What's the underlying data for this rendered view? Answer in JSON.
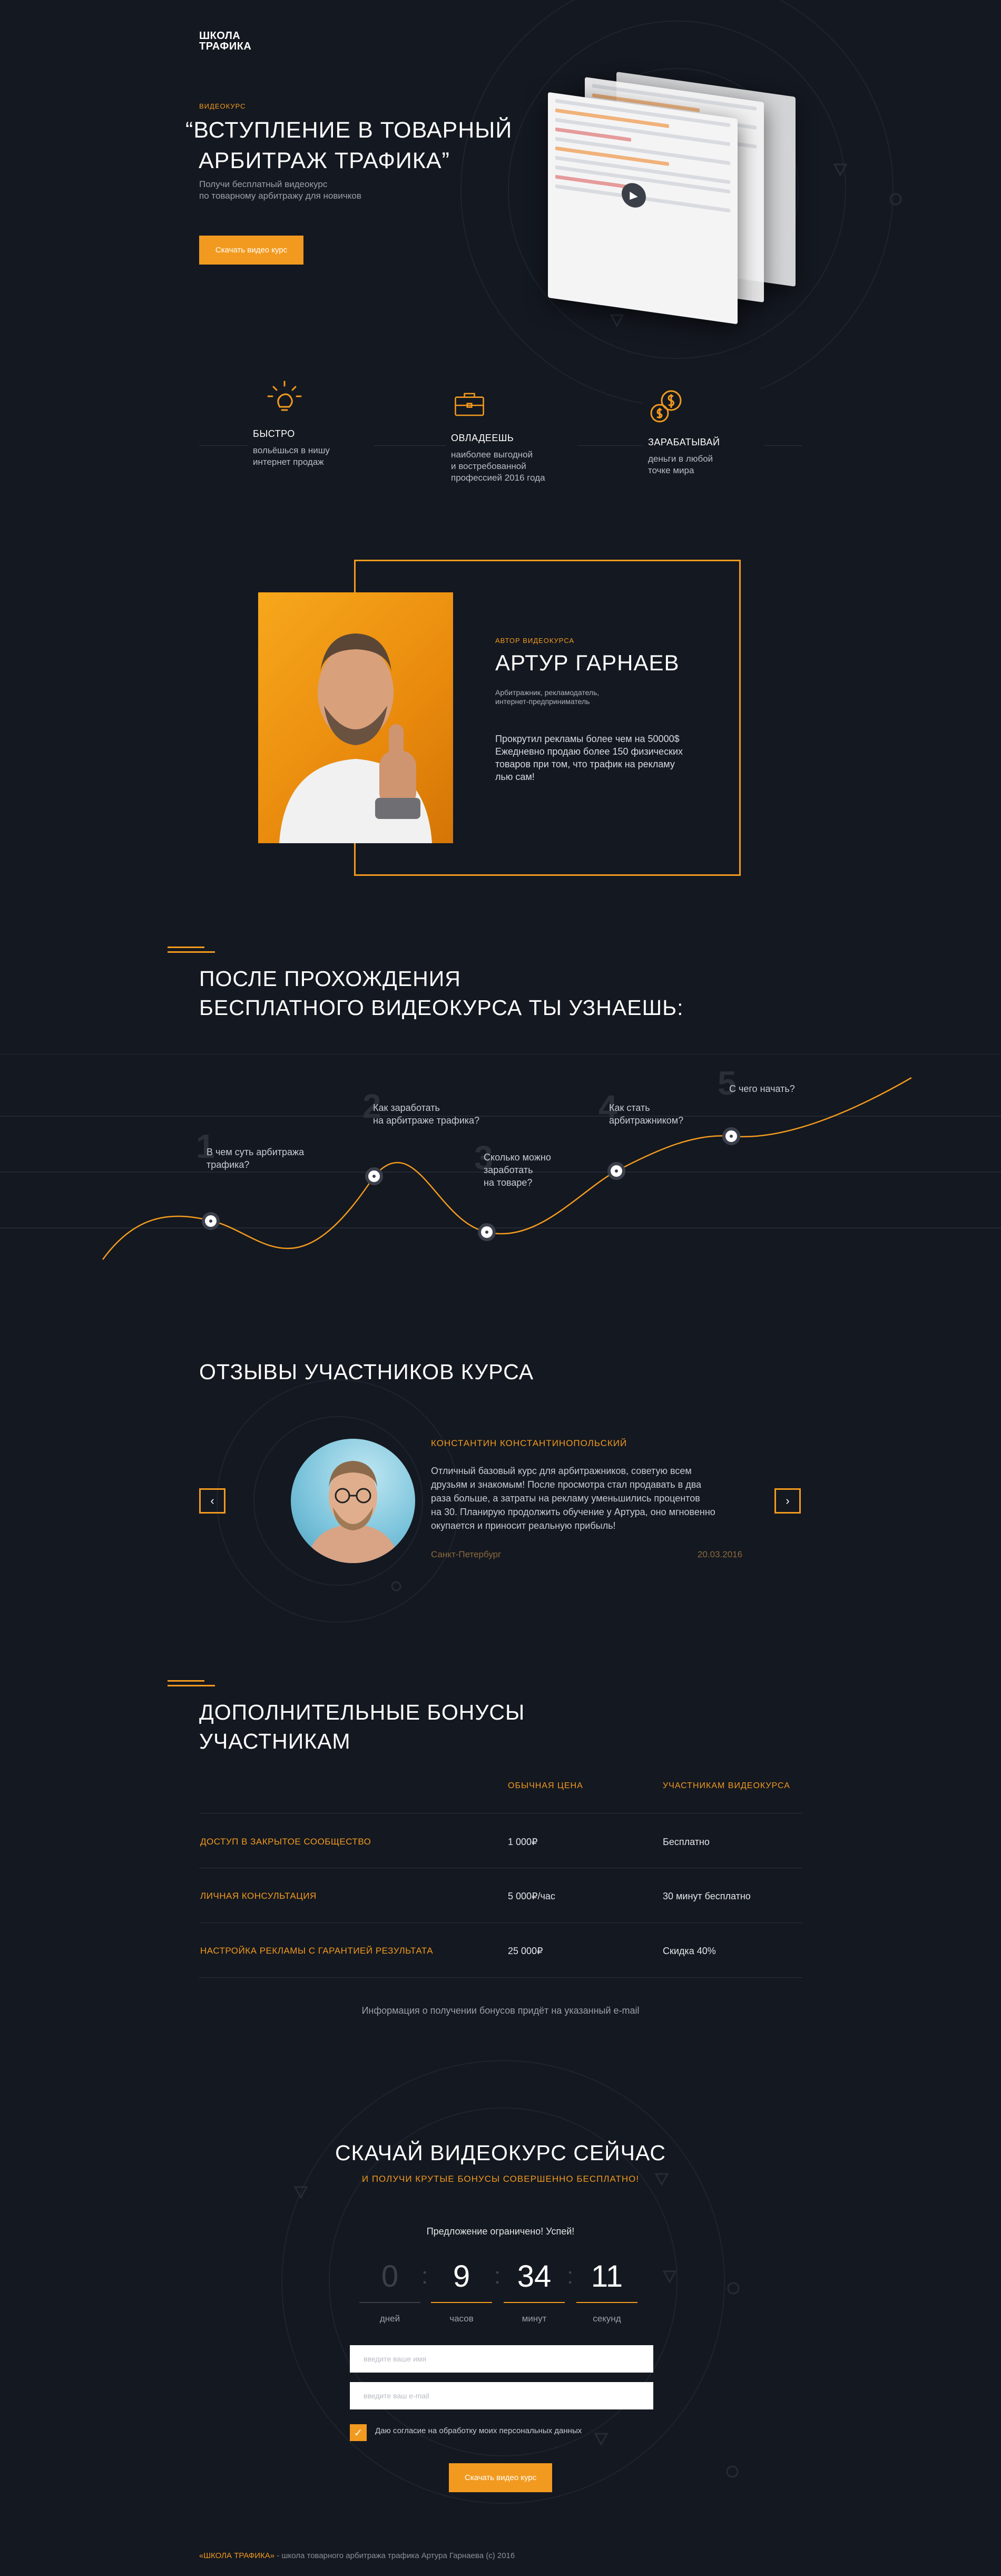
{
  "colors": {
    "accent": "#f29a1f",
    "background": "#141820"
  },
  "header": {
    "logo_line1": "ШКОЛА",
    "logo_line2": "ТРАФИКА"
  },
  "hero": {
    "tag": "ВИДЕОКУРС",
    "title_line1": "“ВСТУПЛЕНИЕ В ТОВАРНЫЙ",
    "title_line2": "АРБИТРАЖ ТРАФИКА”",
    "subtitle_line1": "Получи бесплатный видеокурс",
    "subtitle_line2": "по товарному арбитражу для новичков",
    "button": "Скачать видео курс"
  },
  "features": [
    {
      "icon": "lightbulb-icon",
      "title": "БЫСТРО",
      "desc_line1": "вольёшься в нишу",
      "desc_line2": "интернет продаж",
      "desc_line3": ""
    },
    {
      "icon": "briefcase-icon",
      "title": "ОВЛАДЕЕШЬ",
      "desc_line1": "наиболее выгодной",
      "desc_line2": "и востребованной",
      "desc_line3": "профессией 2016 года"
    },
    {
      "icon": "coins-icon",
      "title": "ЗАРАБАТЫВАЙ",
      "desc_line1": "деньги в любой",
      "desc_line2": "точке мира",
      "desc_line3": ""
    }
  ],
  "author": {
    "label": "АВТОР ВИДЕОКУРСА",
    "name": "АРТУР ГАРНАЕВ",
    "role_line1": "Арбитражник, рекламодатель,",
    "role_line2": "интернет-предприниматель",
    "text_line1": "Прокрутил рекламы более чем на 50000$",
    "text_line2": "Ежедневно продаю более 150 физических",
    "text_line3": "товаров при том, что трафик на рекламу",
    "text_line4": "лью сам!"
  },
  "learn": {
    "title_line1": "ПОСЛЕ ПРОХОЖДЕНИЯ",
    "title_line2": "БЕСПЛАТНОГО ВИДЕОКУРСА ТЫ УЗНАЕШЬ:",
    "points": [
      {
        "num": "1",
        "line1": "В чем суть арбитража",
        "line2": "трафика?",
        "line3": ""
      },
      {
        "num": "2",
        "line1": "Как заработать",
        "line2": "на арбитраже трафика?",
        "line3": ""
      },
      {
        "num": "3",
        "line1": "Сколько можно",
        "line2": "заработать",
        "line3": "на товаре?"
      },
      {
        "num": "4",
        "line1": "Как стать",
        "line2": "арбитражником?",
        "line3": ""
      },
      {
        "num": "5",
        "line1": "С чего начать?",
        "line2": "",
        "line3": ""
      }
    ]
  },
  "reviews": {
    "title": "ОТЗЫВЫ УЧАСТНИКОВ КУРСА",
    "prev": "‹",
    "next": "›",
    "name": "КОНСТАНТИН КОНСТАНТИНОПОЛЬСКИЙ",
    "text_line1": "Отличный базовый курс для арбитражников, советую всем",
    "text_line2": "друзьям и знакомым! После просмотра стал продавать в два",
    "text_line3": "раза больше, а затраты на рекламу уменьшились процентов",
    "text_line4": "на 30. Планирую продолжить обучение у Артура, оно мгновенно",
    "text_line5": "окупается и приносит реальную прибыль!",
    "city": "Санкт-Петербург",
    "date": "20.03.2016"
  },
  "bonuses": {
    "title_line1": "ДОПОЛНИТЕЛЬНЫЕ БОНУСЫ",
    "title_line2": "УЧАСТНИКАМ",
    "col_regular": "ОБЫЧНАЯ ЦЕНА",
    "col_members": "УЧАСТНИКАМ ВИДЕОКУРСА",
    "rows": [
      {
        "name": "ДОСТУП В ЗАКРЫТОЕ СООБЩЕСТВО",
        "regular": "1 000₽",
        "members": "Бесплатно"
      },
      {
        "name": "ЛИЧНАЯ КОНСУЛЬТАЦИЯ",
        "regular": "5 000₽/час",
        "members": "30 минут бесплатно"
      },
      {
        "name": "НАСТРОЙКА РЕКЛАМЫ С ГАРАНТИЕЙ РЕЗУЛЬТАТА",
        "regular": "25 000₽",
        "members": "Скидка 40%"
      }
    ],
    "note": "Информация о получении бонусов придёт на указанный e-mail"
  },
  "download": {
    "title": "СКАЧАЙ ВИДЕОКУРС СЕЙЧАС",
    "subtitle": "И ПОЛУЧИ КРУТЫЕ БОНУСЫ СОВЕРШЕННО БЕСПЛАТНО!",
    "limited": "Предложение ограничено! Успей!",
    "countdown": [
      {
        "value": "0",
        "label": "дней"
      },
      {
        "value": "9",
        "label": "часов"
      },
      {
        "value": "34",
        "label": "минут"
      },
      {
        "value": "11",
        "label": "секунд"
      }
    ],
    "name_placeholder": "введите ваше имя",
    "email_placeholder": "введите ваш e-mail",
    "agree": "Даю согласие на обработку моих персональных данных",
    "agree_check": "✓",
    "button": "Скачать видео курс"
  },
  "footer": {
    "brand": "«ШКОЛА ТРАФИКА»",
    "text": " - школа товарного арбитража трафика Артура Гарнаева (c) 2016"
  }
}
